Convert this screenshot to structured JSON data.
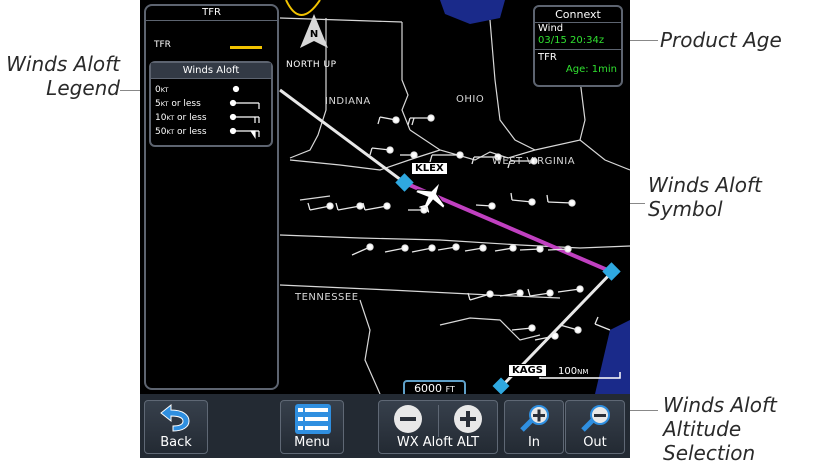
{
  "callouts": {
    "legend_line1": "Winds Aloft",
    "legend_line2": "Legend",
    "product_age": "Product Age",
    "symbol_line1": "Winds Aloft",
    "symbol_line2": "Symbol",
    "altitude_line1": "Winds Aloft",
    "altitude_line2": "Altitude Selection"
  },
  "legend": {
    "header": "TFR",
    "tfr_label": "TFR",
    "tfr_color": "#f2c300",
    "winds_title": "Winds Aloft",
    "items": [
      {
        "value": "0",
        "unit": "KT",
        "suffix": ""
      },
      {
        "value": "5",
        "unit": "KT",
        "suffix": " or less"
      },
      {
        "value": "10",
        "unit": "KT",
        "suffix": " or less"
      },
      {
        "value": "50",
        "unit": "KT",
        "suffix": " or less"
      }
    ]
  },
  "connext": {
    "title": "Connext",
    "wind_label": "Wind",
    "wind_time": "03/15 20:34z",
    "tfr_label": "TFR",
    "tfr_age": "Age: 1min"
  },
  "map": {
    "orientation": "NORTH UP",
    "compass": "N",
    "states": [
      "INDIANA",
      "OHIO",
      "WEST VIRGINIA",
      "TENNESSEE"
    ],
    "waypoints": [
      "KLEX",
      "KAGS"
    ],
    "scale": "100",
    "scale_unit": "NM",
    "route_color": "#c040c0"
  },
  "altitude": {
    "value": "6000",
    "unit": "FT"
  },
  "toolbar": {
    "back": "Back",
    "menu": "Menu",
    "wx_aloft_alt": "WX Aloft ALT",
    "zoom_in": "In",
    "zoom_out": "Out"
  }
}
